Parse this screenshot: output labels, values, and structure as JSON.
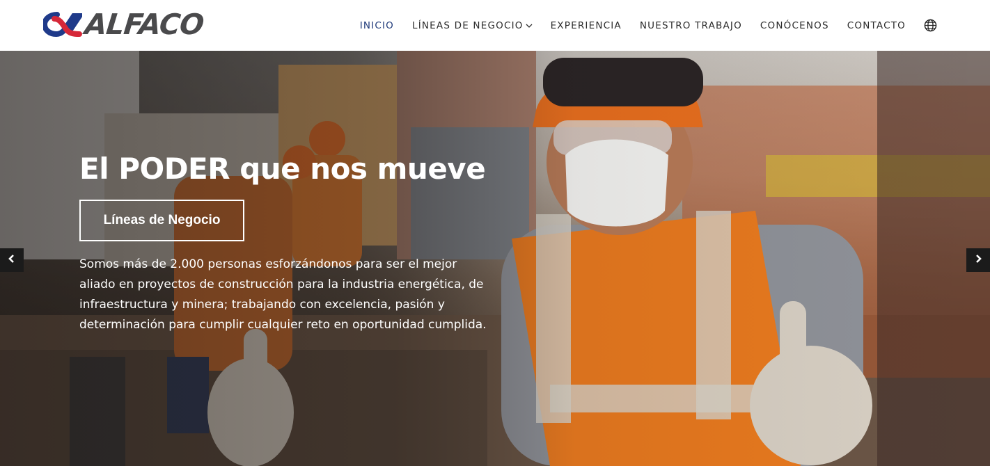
{
  "brand": {
    "name": "ALFACO",
    "colors": {
      "blue": "#1f3a8a",
      "red": "#d62839",
      "gray": "#4a4a4c"
    }
  },
  "nav": {
    "items": [
      {
        "label": "INICIO",
        "active": true
      },
      {
        "label": "LÍNEAS DE NEGOCIO",
        "has_dropdown": true
      },
      {
        "label": "EXPERIENCIA"
      },
      {
        "label": "NUESTRO TRABAJO"
      },
      {
        "label": "CONÓCENOS"
      },
      {
        "label": "CONTACTO"
      }
    ],
    "language_icon": "globe-icon"
  },
  "hero": {
    "title": "El PODER que nos mueve",
    "button_label": "Líneas de Negocio",
    "description": "Somos más de 2.000 personas esforzándonos para ser el mejor aliado en proyectos de construcción para la industria energética, de infraestructura y minera; trabajando con excelencia, pasión y determinación para cumplir cualquier reto en oportunidad cumplida.",
    "prev_icon": "chevron-left-icon",
    "next_icon": "chevron-right-icon"
  }
}
